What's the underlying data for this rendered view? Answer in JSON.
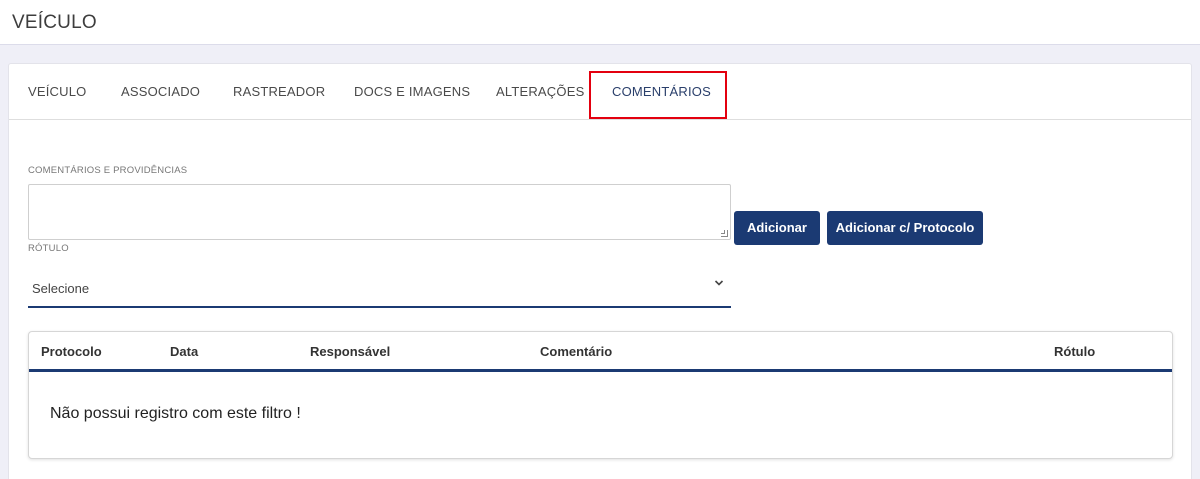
{
  "header": {
    "title": "VEÍCULO"
  },
  "tabs": [
    {
      "label": "VEÍCULO",
      "active": false
    },
    {
      "label": "ASSOCIADO",
      "active": false
    },
    {
      "label": "RASTREADOR",
      "active": false
    },
    {
      "label": "DOCS E IMAGENS",
      "active": false
    },
    {
      "label": "ALTERAÇÕES",
      "active": false
    },
    {
      "label": "COMENTÁRIOS",
      "active": true
    }
  ],
  "form": {
    "comment_label": "COMENTÁRIOS E PROVIDÊNCIAS",
    "comment_value": "",
    "label_field_label": "RÓTULO",
    "label_select_value": "Selecione",
    "add_button": "Adicionar",
    "add_protocol_button": "Adicionar c/ Protocolo"
  },
  "table": {
    "columns": [
      "Protocolo",
      "Data",
      "Responsável",
      "Comentário",
      "Rótulo"
    ],
    "rows": [],
    "empty_message": "Não possui registro com este filtro !"
  },
  "colors": {
    "primary": "#1b3a73",
    "highlight": "#e3000f",
    "background": "#efeff7"
  }
}
